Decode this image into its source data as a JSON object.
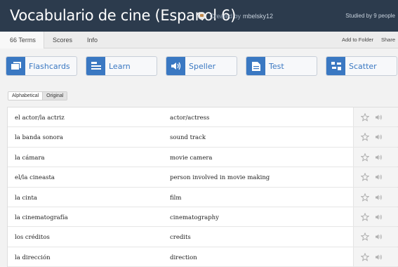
{
  "header": {
    "title": "Vocabulario de cine (Espanol 6)",
    "created_by_label": "Created by",
    "creator": "mbelsky12",
    "studied": "Studied by 9 people"
  },
  "tabs": [
    {
      "label": "66 Terms",
      "active": true
    },
    {
      "label": "Scores",
      "active": false
    },
    {
      "label": "Info",
      "active": false
    }
  ],
  "actions": {
    "add_to_folder": "Add to Folder",
    "share": "Share"
  },
  "modes": [
    {
      "label": "Flashcards",
      "icon": "flashcards-icon"
    },
    {
      "label": "Learn",
      "icon": "learn-icon"
    },
    {
      "label": "Speller",
      "icon": "speaker-icon"
    },
    {
      "label": "Test",
      "icon": "test-icon"
    },
    {
      "label": "Scatter",
      "icon": "scatter-icon"
    }
  ],
  "sort": {
    "alphabetical": "Alphabetical",
    "original": "Original",
    "selected": "Original"
  },
  "terms": [
    {
      "term": "el actor/la actriz",
      "definition": "actor/actress"
    },
    {
      "term": "la banda sonora",
      "definition": "sound track"
    },
    {
      "term": "la cámara",
      "definition": "movie camera"
    },
    {
      "term": "el/la cineasta",
      "definition": "person involved in movie making"
    },
    {
      "term": "la cinta",
      "definition": "film"
    },
    {
      "term": "la cinematografía",
      "definition": "cinematography"
    },
    {
      "term": "los créditos",
      "definition": "credits"
    },
    {
      "term": "la dirección",
      "definition": "direction"
    }
  ],
  "colors": {
    "header_bg": "#2c3b4d",
    "accent": "#3a78c2"
  }
}
